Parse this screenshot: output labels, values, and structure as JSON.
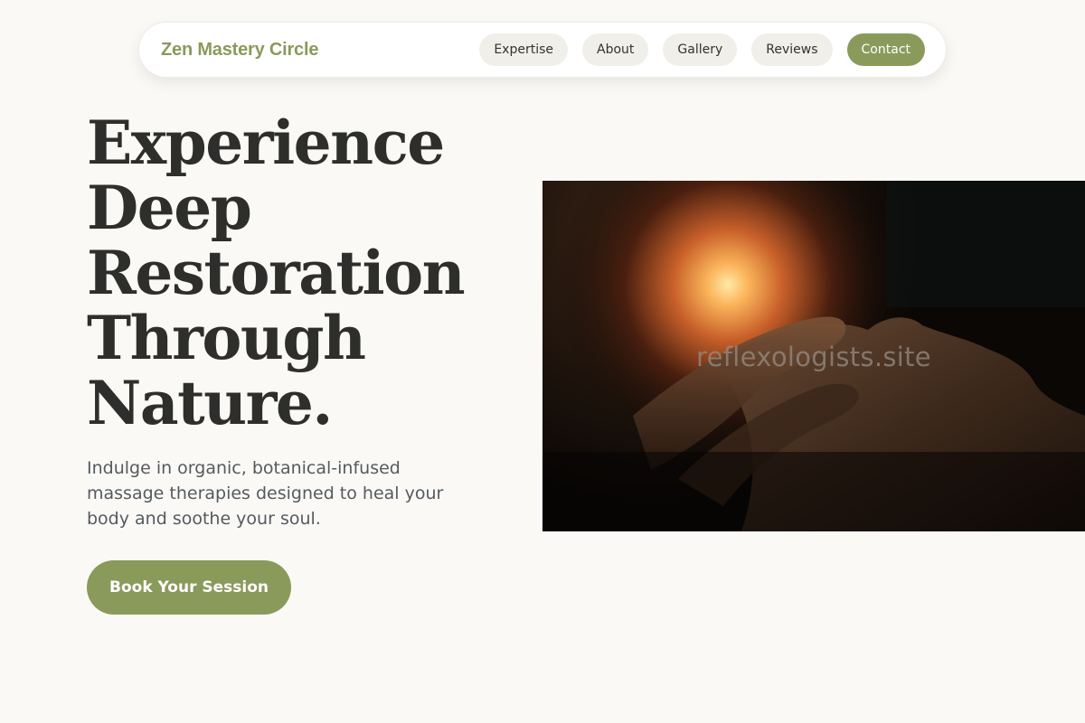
{
  "nav": {
    "brand": "Zen Mastery Circle",
    "links": [
      {
        "label": "Expertise"
      },
      {
        "label": "About"
      },
      {
        "label": "Gallery"
      },
      {
        "label": "Reviews"
      },
      {
        "label": "Contact"
      }
    ]
  },
  "hero": {
    "title_lines": [
      "Experience",
      "Deep",
      "Restoration",
      "Through",
      "Nature."
    ],
    "subtitle": "Indulge in organic, botanical-infused massage therapies designed to heal your body and soothe your soul.",
    "cta_label": "Book Your Session",
    "image_watermark": "reflexologists.site"
  },
  "colors": {
    "accent": "#8a9a5b",
    "background": "#faf9f5",
    "heading": "#2e2e2c",
    "body_text": "#555a60",
    "pill": "#f0efe9"
  }
}
